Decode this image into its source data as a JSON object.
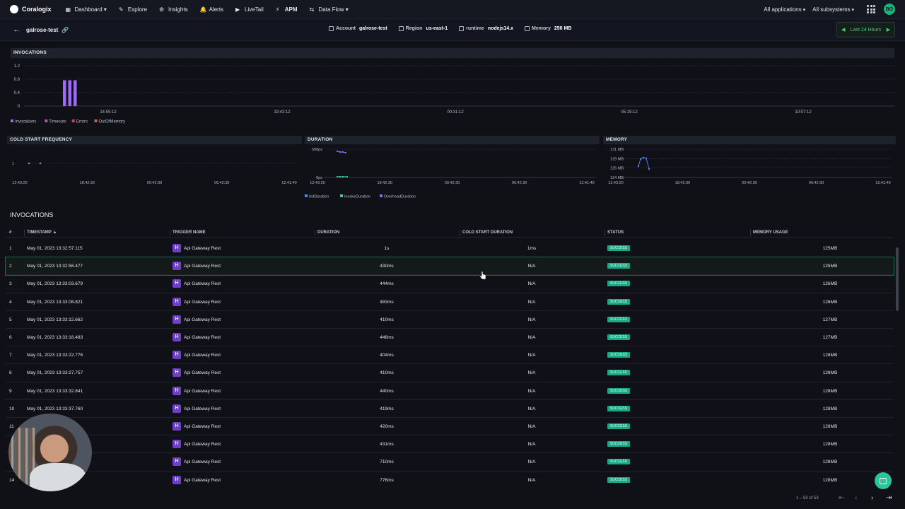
{
  "nav": {
    "brand": "Coralogix",
    "items": [
      {
        "label": "Dashboard ▾",
        "icon": "grid-icon"
      },
      {
        "label": "Explore",
        "icon": "explore-icon"
      },
      {
        "label": "Insights",
        "icon": "gear-icon"
      },
      {
        "label": "Alerts",
        "icon": "bell-icon"
      },
      {
        "label": "LiveTail",
        "icon": "play-icon"
      },
      {
        "label": "APM",
        "icon": "apm-icon"
      },
      {
        "label": "Data Flow ▾",
        "icon": "dataflow-icon"
      }
    ],
    "applications": "All applications",
    "subsystems": "All subsystems",
    "avatar": "BO"
  },
  "function": {
    "name": "galrose-test",
    "account_label": "Account",
    "account": "galrose-test",
    "region_label": "Region",
    "region": "us-east-1",
    "runtime_label": "runtime",
    "runtime": "nodejs14.x",
    "memory_label": "Memory",
    "memory": "256 MB",
    "time_range": "Last 24 Hours"
  },
  "charts": {
    "invocations_title": "INVOCATIONS",
    "cold_title": "COLD START FREQUENCY",
    "duration_title": "DURATION",
    "memory_title": "MEMORY"
  },
  "chart_data": [
    {
      "type": "bar",
      "title": "INVOCATIONS",
      "y_ticks": [
        "1.2",
        "0.8",
        "0.4",
        "0"
      ],
      "ylim": [
        0,
        1.2
      ],
      "x_ticks": [
        "14:55:12",
        "19:43:12",
        "00:31:12",
        "05:19:12",
        "10:07:12"
      ],
      "bars": [
        1,
        1,
        1
      ],
      "series": [
        {
          "name": "Invocations",
          "color": "#9b6cf3"
        },
        {
          "name": "Timeouts",
          "color": "#c24fb1"
        },
        {
          "name": "Errors",
          "color": "#d0445b"
        },
        {
          "name": "OutOfMemory",
          "color": "#e05a5a"
        }
      ],
      "legend": "bottom-left"
    },
    {
      "type": "scatter",
      "title": "COLD START FREQUENCY",
      "y_ticks": [
        "1"
      ],
      "x_ticks": [
        "12:43:20",
        "18:42:30",
        "00:42:30",
        "06:42:30",
        "12:41:40"
      ],
      "points": [
        1,
        1
      ]
    },
    {
      "type": "line",
      "title": "DURATION",
      "y_ticks": [
        "500ps",
        "0ps"
      ],
      "x_ticks": [
        "12:43:20",
        "18:42:30",
        "00:42:30",
        "06:42:30",
        "12:41:40"
      ],
      "series": [
        {
          "name": "InitDuration",
          "color": "#4f86ff"
        },
        {
          "name": "InvokeDuration",
          "color": "#3fcf8e"
        },
        {
          "name": "OverheadDuration",
          "color": "#8a6cf3"
        }
      ],
      "legend": "bottom-left"
    },
    {
      "type": "line",
      "title": "MEMORY",
      "y_ticks": [
        "131 MB",
        "129 MB",
        "126 MB",
        "124 MB"
      ],
      "x_ticks": [
        "12:43:20",
        "18:42:30",
        "00:42:30",
        "06:42:30",
        "12:41:40"
      ],
      "values": [
        125,
        129,
        129,
        126,
        125
      ]
    }
  ],
  "table": {
    "section_title": "INVOCATIONS",
    "columns": [
      "#",
      "TIMESTAMP ▲",
      "TRIGGER NAME",
      "DURATION",
      "COLD START DURATION",
      "STATUS",
      "MEMORY USAGE"
    ],
    "rows": [
      {
        "n": "1",
        "ts": "May 01, 2023 13:32:57.115",
        "trigger": "Api Gateway Rest",
        "dur": "1s",
        "cold": "1ms",
        "status": "SUCCESS",
        "mem": "125MB"
      },
      {
        "n": "2",
        "ts": "May 01, 2023 13:32:58.477",
        "trigger": "Api Gateway Rest",
        "dur": "430ms",
        "cold": "N/A",
        "status": "SUCCESS",
        "mem": "125MB"
      },
      {
        "n": "3",
        "ts": "May 01, 2023 13:33:03.679",
        "trigger": "Api Gateway Rest",
        "dur": "444ms",
        "cold": "N/A",
        "status": "SUCCESS",
        "mem": "126MB"
      },
      {
        "n": "4",
        "ts": "May 01, 2023 13:33:08.821",
        "trigger": "Api Gateway Rest",
        "dur": "483ms",
        "cold": "N/A",
        "status": "SUCCESS",
        "mem": "126MB"
      },
      {
        "n": "5",
        "ts": "May 01, 2023 13:33:12.662",
        "trigger": "Api Gateway Rest",
        "dur": "410ms",
        "cold": "N/A",
        "status": "SUCCESS",
        "mem": "127MB"
      },
      {
        "n": "6",
        "ts": "May 01, 2023 13:33:18.483",
        "trigger": "Api Gateway Rest",
        "dur": "446ms",
        "cold": "N/A",
        "status": "SUCCESS",
        "mem": "127MB"
      },
      {
        "n": "7",
        "ts": "May 01, 2023 13:33:22.776",
        "trigger": "Api Gateway Rest",
        "dur": "404ms",
        "cold": "N/A",
        "status": "SUCCESS",
        "mem": "128MB"
      },
      {
        "n": "8",
        "ts": "May 01, 2023 13:33:27.757",
        "trigger": "Api Gateway Rest",
        "dur": "410ms",
        "cold": "N/A",
        "status": "SUCCESS",
        "mem": "128MB"
      },
      {
        "n": "9",
        "ts": "May 01, 2023 13:33:32.841",
        "trigger": "Api Gateway Rest",
        "dur": "440ms",
        "cold": "N/A",
        "status": "SUCCESS",
        "mem": "128MB"
      },
      {
        "n": "10",
        "ts": "May 01, 2023 13:33:37.760",
        "trigger": "Api Gateway Rest",
        "dur": "419ms",
        "cold": "N/A",
        "status": "SUCCESS",
        "mem": "128MB"
      },
      {
        "n": "11",
        "ts": "",
        "trigger": "Api Gateway Rest",
        "dur": "420ms",
        "cold": "N/A",
        "status": "SUCCESS",
        "mem": "128MB"
      },
      {
        "n": "12",
        "ts": "",
        "trigger": "Api Gateway Rest",
        "dur": "431ms",
        "cold": "N/A",
        "status": "SUCCESS",
        "mem": "128MB"
      },
      {
        "n": "13",
        "ts": "",
        "trigger": "Api Gateway Rest",
        "dur": "710ms",
        "cold": "N/A",
        "status": "SUCCESS",
        "mem": "128MB"
      },
      {
        "n": "14",
        "ts": "",
        "trigger": "Api Gateway Rest",
        "dur": "776ms",
        "cold": "N/A",
        "status": "SUCCESS",
        "mem": "128MB"
      }
    ],
    "pager": "1 – 50 of 53"
  }
}
